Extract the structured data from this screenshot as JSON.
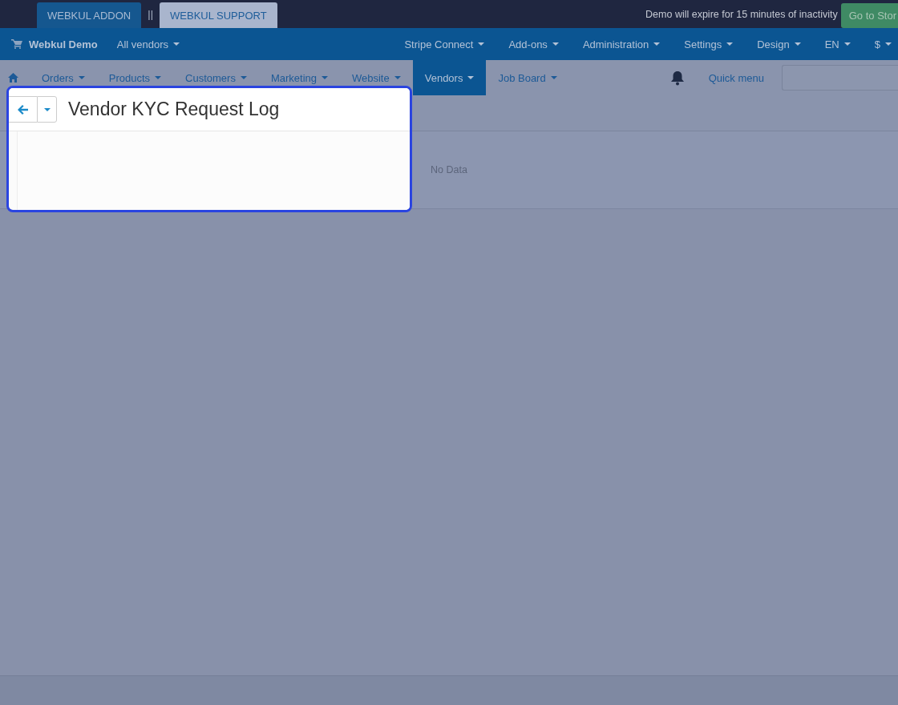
{
  "top_bar": {
    "buttons": [
      {
        "label": "WEBKUL ADDON",
        "kind": "primary"
      },
      {
        "label": "WEBKUL SUPPORT",
        "kind": "light"
      }
    ],
    "separator": "||",
    "notice": "Demo will expire for 15 minutes of inactivity",
    "store_button": "Go to Stor"
  },
  "nav_bar": {
    "brand": "Webkul Demo",
    "vendor_selector": "All vendors",
    "menus": [
      "Stripe Connect",
      "Add-ons",
      "Administration",
      "Settings",
      "Design",
      "EN",
      "$"
    ]
  },
  "menu_bar": {
    "items": [
      {
        "label": "Orders",
        "selected": false
      },
      {
        "label": "Products",
        "selected": false
      },
      {
        "label": "Customers",
        "selected": false
      },
      {
        "label": "Marketing",
        "selected": false
      },
      {
        "label": "Website",
        "selected": false
      },
      {
        "label": "Vendors",
        "selected": true
      },
      {
        "label": "Job Board",
        "selected": false
      }
    ],
    "quick_menu": "Quick menu"
  },
  "page": {
    "title": "Vendor KYC Request Log",
    "empty_text": "No Data"
  }
}
